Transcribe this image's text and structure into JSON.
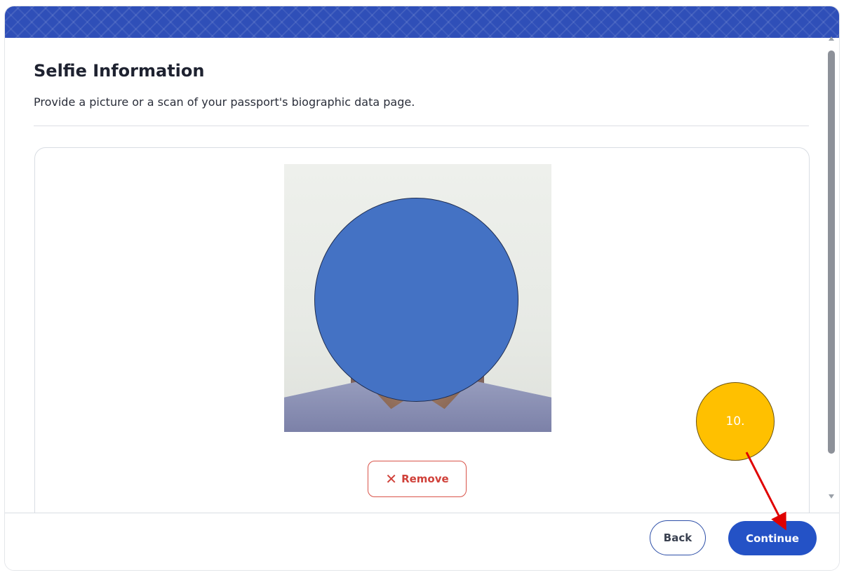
{
  "page": {
    "title": "Selfie Information",
    "subtitle": "Provide a picture or a scan of your passport's biographic data page."
  },
  "upload": {
    "remove_label": "Remove",
    "remove_icon": "close-icon"
  },
  "footer": {
    "back_label": "Back",
    "continue_label": "Continue"
  },
  "annotation": {
    "step_label": "10."
  },
  "colors": {
    "primary": "#2452c6",
    "danger": "#d0413a",
    "marker": "#ffc000",
    "arrow": "#e00000",
    "face_cover": "#4472c4"
  }
}
